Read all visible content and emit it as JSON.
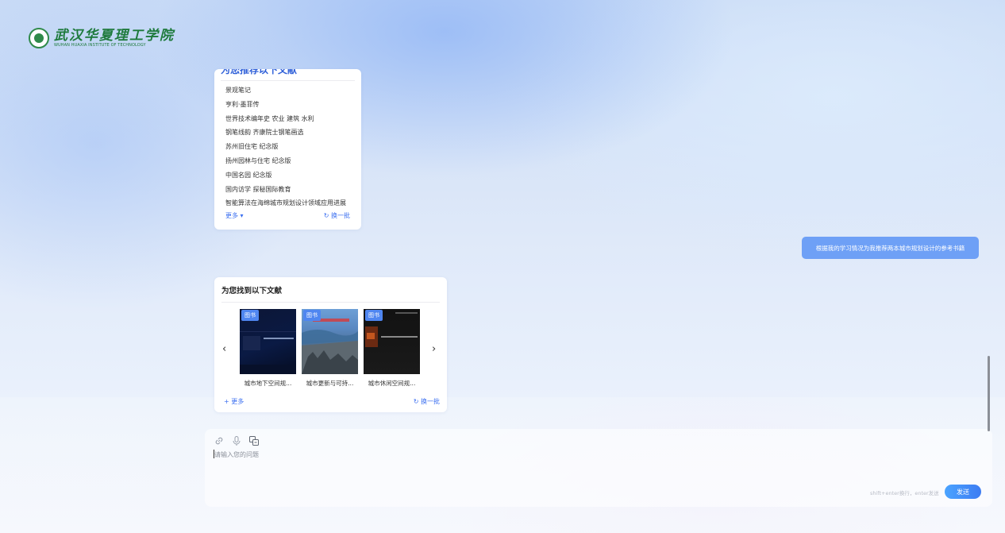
{
  "logo": {
    "name_cn": "武汉华夏理工学院",
    "name_en": "WUHAN HUAXIA INSTITUTE OF TECHNOLOGY"
  },
  "recommend_card": {
    "title": "为您推荐以下文献",
    "items": [
      "景观笔记",
      "亨利·墨菲传",
      "世界技术编年史 农业 建筑 水利",
      "钢笔线韵 齐康院士钢笔画选",
      "苏州旧住宅 纪念版",
      "扬州园林与住宅 纪念版",
      "中国名园 纪念版",
      "国内访学 探秘国际教育",
      "智能算法在海绵城市规划设计领域应用进展"
    ],
    "more_label": "更多 ▾",
    "refresh_label": "↻ 换一批"
  },
  "user_message": "根据我的学习情况为我推荐两本城市规划设计的参考书籍",
  "found_card": {
    "title": "为您找到以下文献",
    "books": [
      {
        "tag": "图书",
        "title": "城市地下空间规..."
      },
      {
        "tag": "图书",
        "title": "城市更新与可持..."
      },
      {
        "tag": "图书",
        "title": "城市休闲空间规..."
      }
    ],
    "more_label": "+ 更多",
    "refresh_label": "↻ 换一批",
    "prev_icon": "chevron-left-icon",
    "next_icon": "chevron-right-icon"
  },
  "input": {
    "placeholder": "请输入您的问题",
    "hint": "shift+enter换行，enter发送",
    "send_label": "发送",
    "tools": [
      "link-icon",
      "microphone-icon",
      "translate-icon"
    ]
  },
  "colors": {
    "accent": "#3b6ff0",
    "user_bubble": "#6ea0f6",
    "logo_green": "#1e7a3c"
  }
}
